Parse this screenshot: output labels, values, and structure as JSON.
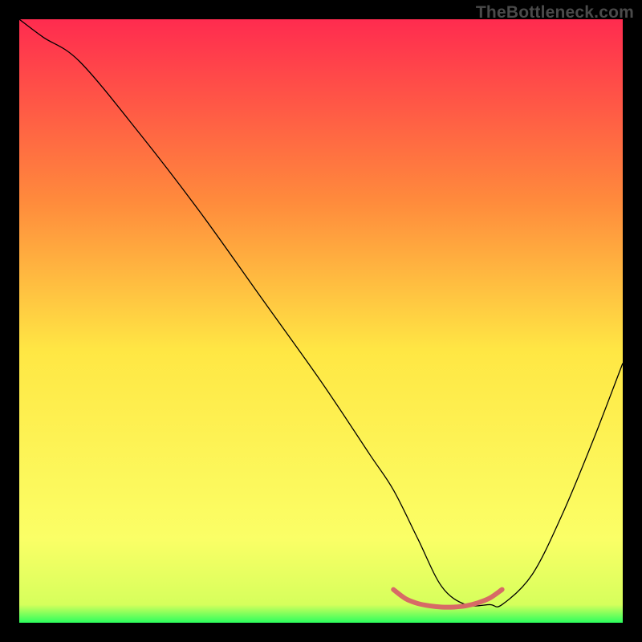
{
  "watermark": "TheBottleneck.com",
  "chart_data": {
    "type": "line",
    "title": "",
    "xlabel": "",
    "ylabel": "",
    "xlim": [
      0,
      100
    ],
    "ylim": [
      0,
      100
    ],
    "grid": false,
    "background_gradient": {
      "top": "#ff2b4f",
      "mid_upper": "#ff8a3c",
      "mid": "#ffe744",
      "mid_lower": "#fbff66",
      "bottom": "#2bff5d"
    },
    "series": [
      {
        "name": "main-curve",
        "color": "#000000",
        "stroke_width": 1.3,
        "x": [
          0,
          4,
          10,
          20,
          30,
          40,
          50,
          58,
          62,
          66,
          70,
          74,
          78,
          80,
          85,
          90,
          95,
          100
        ],
        "y": [
          100,
          97,
          93,
          81,
          68,
          54,
          40,
          28,
          22,
          14,
          6,
          3,
          3,
          3,
          8,
          18,
          30,
          43
        ]
      },
      {
        "name": "highlight-segment",
        "color": "#d76a66",
        "stroke_width": 6,
        "x": [
          62,
          64,
          66,
          68,
          70,
          72,
          74,
          76,
          78,
          80
        ],
        "y": [
          5.5,
          4.0,
          3.2,
          2.8,
          2.6,
          2.6,
          2.8,
          3.3,
          4.1,
          5.5
        ]
      }
    ]
  }
}
